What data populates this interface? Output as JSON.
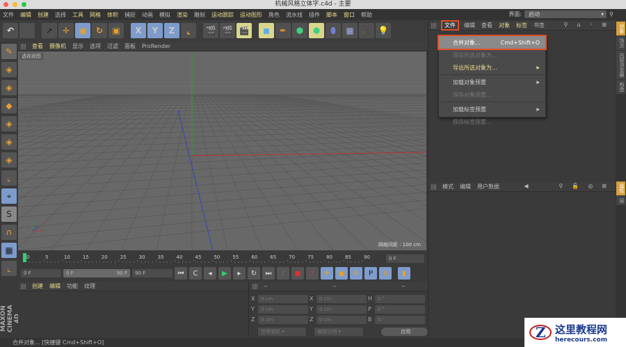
{
  "window": {
    "title": "机械风格立体字.c4d - 主要"
  },
  "menubar": {
    "items": [
      {
        "label": "文件",
        "hl": false
      },
      {
        "label": "编辑",
        "hl": true
      },
      {
        "label": "创建",
        "hl": true
      },
      {
        "label": "选择",
        "hl": false
      },
      {
        "label": "工具",
        "hl": true
      },
      {
        "label": "网格",
        "hl": true
      },
      {
        "label": "体积",
        "hl": true
      },
      {
        "label": "捕捉",
        "hl": false
      },
      {
        "label": "动画",
        "hl": false
      },
      {
        "label": "模拟",
        "hl": false
      },
      {
        "label": "渲染",
        "hl": true
      },
      {
        "label": "雕刻",
        "hl": false
      },
      {
        "label": "运动跟踪",
        "hl": true
      },
      {
        "label": "运动图形",
        "hl": true
      },
      {
        "label": "角色",
        "hl": false
      },
      {
        "label": "流水线",
        "hl": false
      },
      {
        "label": "插件",
        "hl": false
      },
      {
        "label": "脚本",
        "hl": true
      },
      {
        "label": "窗口",
        "hl": true
      },
      {
        "label": "帮助",
        "hl": false
      }
    ],
    "layout_label": "界面:",
    "layout_value": "启动"
  },
  "toolbar": {
    "axis": [
      "X",
      "Y",
      "Z"
    ]
  },
  "viewport": {
    "menu": [
      {
        "label": "查看",
        "hl": true
      },
      {
        "label": "摄像机",
        "hl": true
      },
      {
        "label": "显示",
        "hl": false
      },
      {
        "label": "选项",
        "hl": false
      },
      {
        "label": "过滤",
        "hl": false
      },
      {
        "label": "面板",
        "hl": false
      },
      {
        "label": "ProRender",
        "hl": false
      }
    ],
    "label": "透视视图",
    "grid_spacing": "网格间距 : 100 cm",
    "colors": {
      "x_axis": "#c03030",
      "y_axis": "#30a030",
      "z_axis": "#3040c0"
    }
  },
  "timeline": {
    "ticks": [
      "0",
      "5",
      "10",
      "15",
      "20",
      "25",
      "30",
      "35",
      "40",
      "45",
      "50",
      "55",
      "60",
      "65",
      "70",
      "75",
      "80",
      "85",
      "90"
    ],
    "current": "0 F",
    "start": "0 F",
    "range_start": "0 F",
    "range_end": "90 F",
    "end": "90 F"
  },
  "material": {
    "menu": [
      {
        "label": "创建",
        "hl": true
      },
      {
        "label": "编辑",
        "hl": true
      },
      {
        "label": "功能",
        "hl": false
      },
      {
        "label": "纹理",
        "hl": false
      }
    ]
  },
  "coords": {
    "headers": [
      "--",
      "--",
      "--"
    ],
    "rows": [
      [
        "X",
        "0 cm",
        "X",
        "0 cm",
        "H",
        "0 °"
      ],
      [
        "Y",
        "0 cm",
        "Y",
        "0 cm",
        "P",
        "0 °"
      ],
      [
        "Z",
        "0 cm",
        "Z",
        "0 cm",
        "B",
        "0 °"
      ]
    ],
    "mode1": "世界坐标",
    "mode2": "缩放比例",
    "apply": "应用"
  },
  "objects": {
    "menu": [
      {
        "label": "文件",
        "hl": true
      },
      {
        "label": "编辑",
        "hl": false
      },
      {
        "label": "查看",
        "hl": false
      },
      {
        "label": "对象",
        "hl": true
      },
      {
        "label": "标签",
        "hl": true
      },
      {
        "label": "书签",
        "hl": false
      }
    ]
  },
  "file_menu": {
    "items": [
      {
        "label": "合并对象...",
        "shortcut": "Cmd+Shift+O",
        "state": "active"
      },
      {
        "label": "保存所选对象为...",
        "state": "disabled"
      },
      {
        "label": "导出所选对象为...",
        "state": "yellow",
        "submenu": true
      },
      {
        "sep": true
      },
      {
        "label": "加载对象预置",
        "state": "normal",
        "submenu": true
      },
      {
        "label": "保存对象预置...",
        "state": "disabled"
      },
      {
        "sep": true
      },
      {
        "label": "加载标签预置",
        "state": "normal",
        "submenu": true
      },
      {
        "label": "保存标签预置...",
        "state": "disabled"
      }
    ]
  },
  "attributes": {
    "menu": [
      {
        "label": "模式",
        "hl": false
      },
      {
        "label": "编辑",
        "hl": false
      },
      {
        "label": "用户数据",
        "hl": false
      }
    ]
  },
  "side_tabs": {
    "top": [
      "对象",
      "场次",
      "内容浏览器",
      "构造"
    ],
    "bottom": [
      "属性",
      "层"
    ]
  },
  "status": "合并对象... [快捷键 Cmd+Shift+O]",
  "logo": "MAXON CINEMA 4D",
  "watermark": {
    "title": "这里教程网",
    "url": "herecours.com"
  },
  "accent": "#e0502a"
}
